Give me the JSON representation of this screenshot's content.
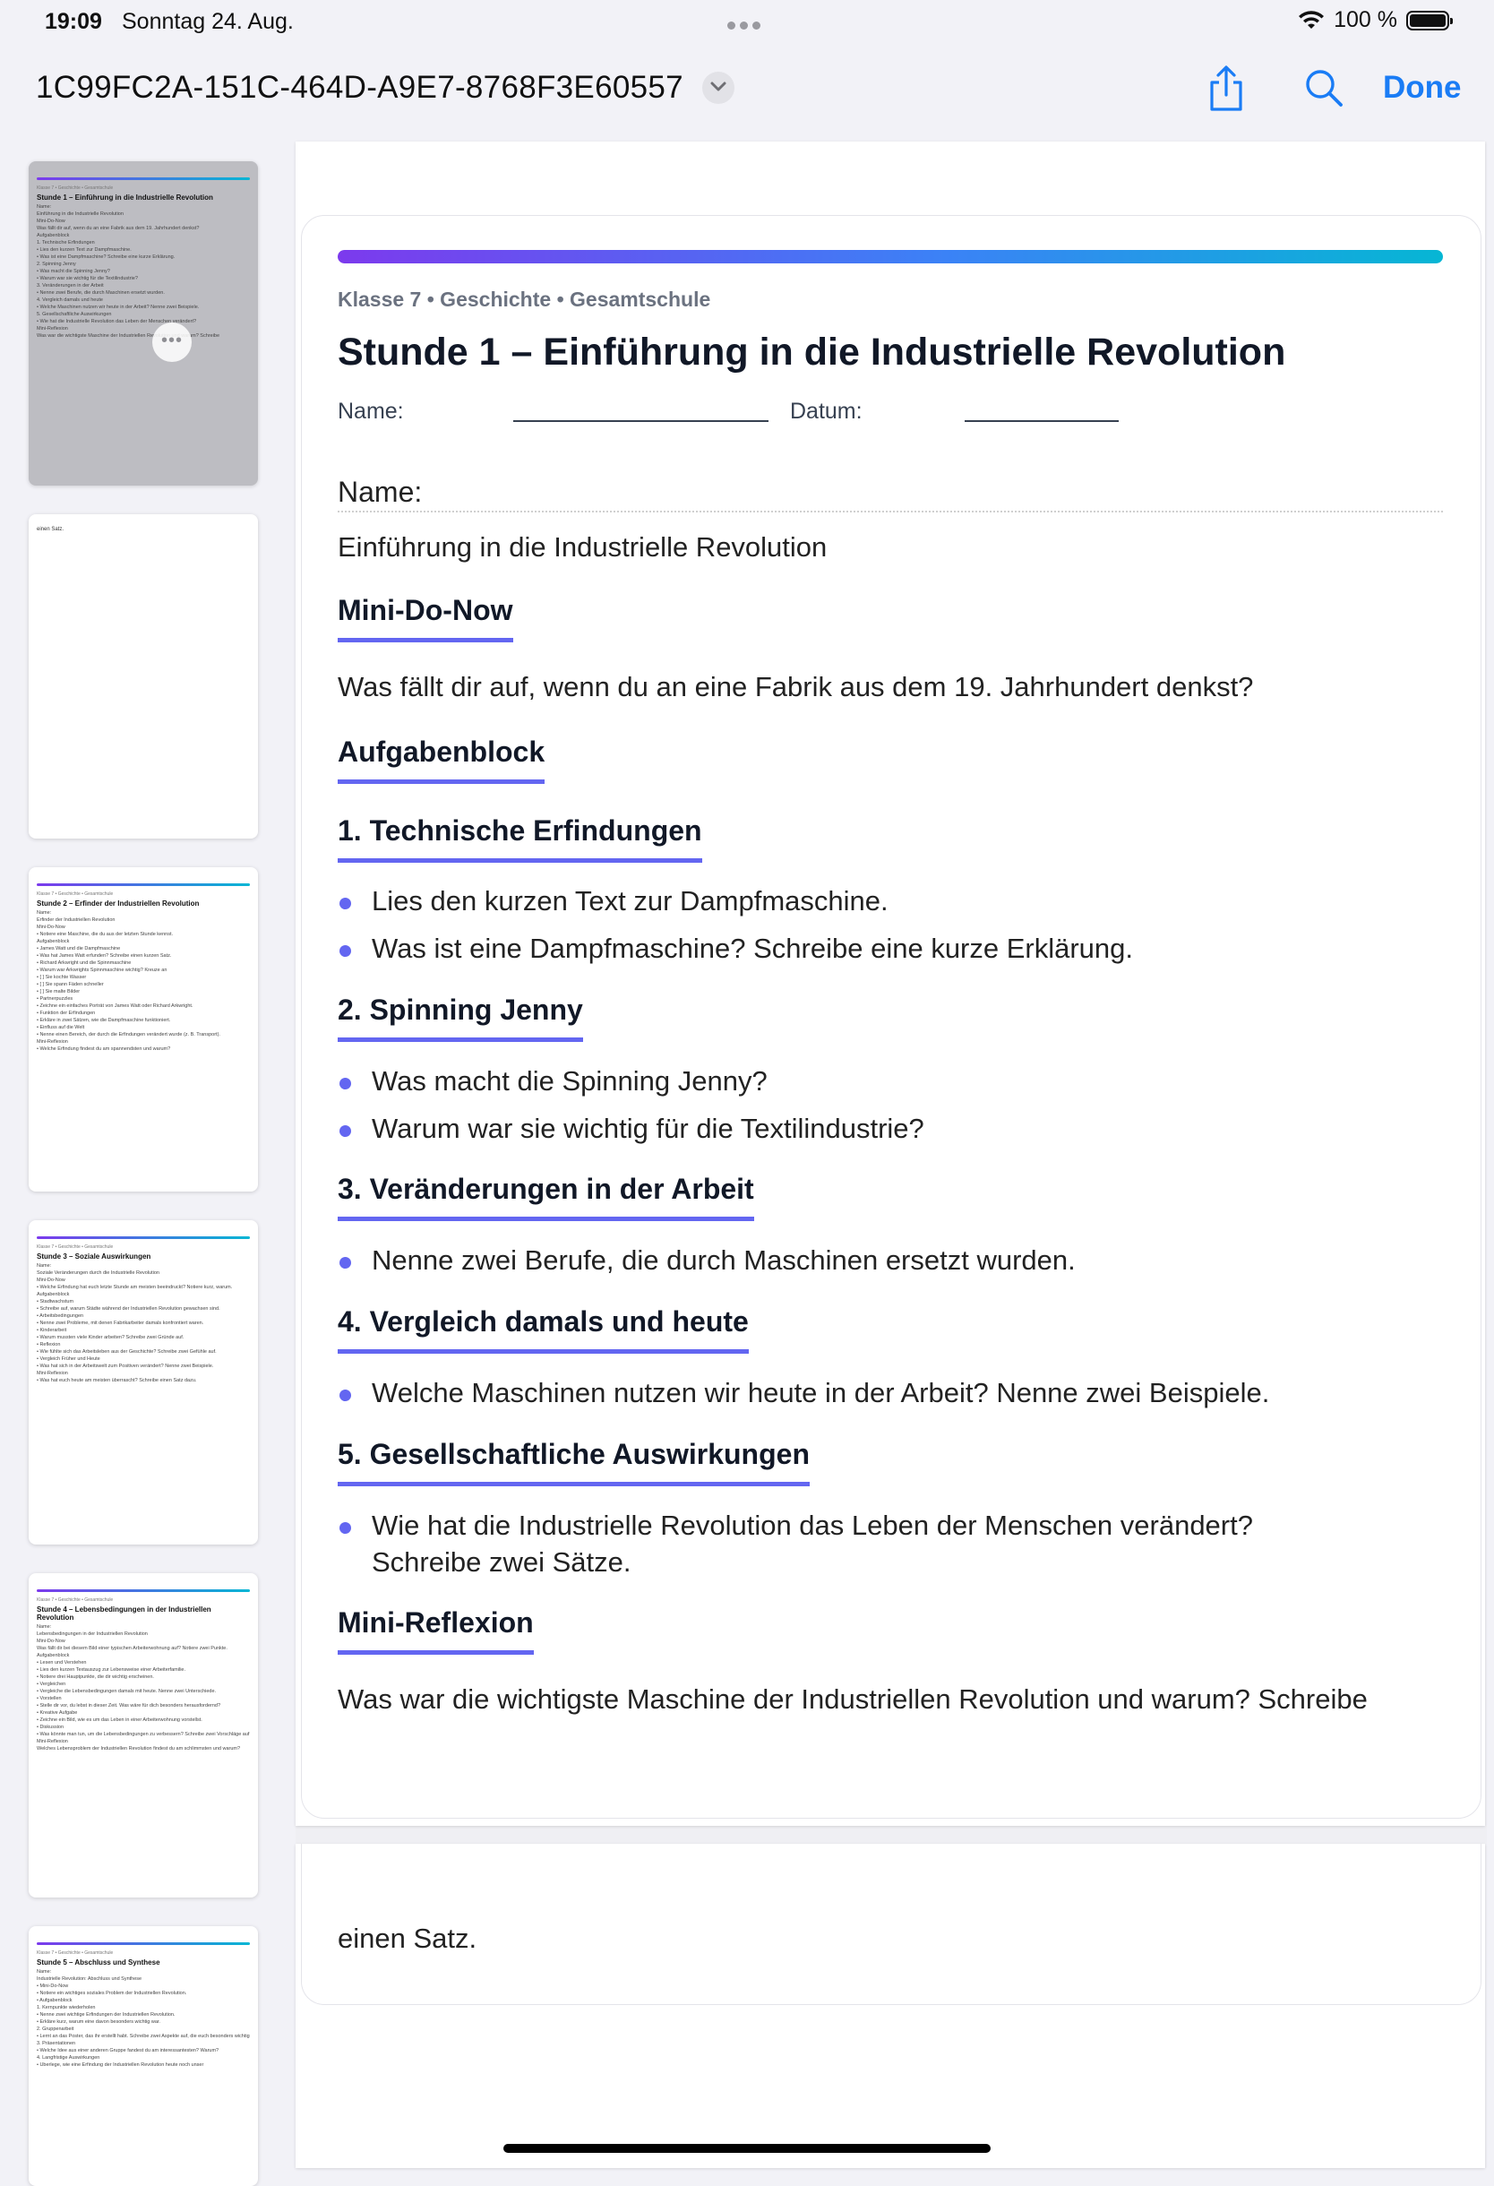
{
  "status": {
    "time": "19:09",
    "date": "Sonntag 24. Aug.",
    "battery": "100 %"
  },
  "nav": {
    "doc_title": "1C99FC2A-151C-464D-A9E7-8768F3E60557",
    "done": "Done"
  },
  "thumbnails": [
    {
      "meta": "Klasse 7 • Geschichte • Gesamtschule",
      "title": "Stunde 1 – Einführung in die Industrielle Revolution",
      "lines": [
        "Name:",
        "Einführung in die Industrielle Revolution",
        "Mini-Do-Now",
        "Was fällt dir auf, wenn du an eine Fabrik aus dem 19. Jahrhundert denkst?",
        "Aufgabenblock",
        "1. Technische Erfindungen",
        "• Lies den kurzen Text zur Dampfmaschine.",
        "• Was ist eine Dampfmaschine? Schreibe eine kurze Erklärung.",
        "2. Spinning Jenny",
        "• Was macht die Spinning Jenny?",
        "• Warum war sie wichtig für die Textilindustrie?",
        "3. Veränderungen in der Arbeit",
        "• Nenne zwei Berufe, die durch Maschinen ersetzt wurden.",
        "4. Vergleich damals und heute",
        "• Welche Maschinen nutzen wir heute in der Arbeit? Nenne zwei Beispiele.",
        "5. Gesellschaftliche Auswirkungen",
        "• Wie hat die Industrielle Revolution das Leben der Menschen verändert?",
        "Mini-Reflexion",
        "Was war die wichtigste Maschine der Industriellen Revolution und warum? Schreibe"
      ]
    },
    {
      "text": "einen Satz."
    },
    {
      "meta": "Klasse 7 • Geschichte • Gesamtschule",
      "title": "Stunde 2 – Erfinder der Industriellen Revolution",
      "lines": [
        "Name:",
        "Erfinder der Industriellen Revolution",
        "Mini-Do-Now",
        "• Notiere eine Maschine, die du aus der letzten Stunde kennst.",
        "Aufgabenblock",
        "• James Watt und die Dampfmaschine",
        "• Was hat James Watt erfunden? Schreibe einen kurzen Satz.",
        "• Richard Arkwright und die Spinnmaschine",
        "• Warum war Arkwrights Spinnmaschine wichtig? Kreuze an",
        "• [ ] Sie kochte Wasser",
        "• [ ] Sie spann Fäden schneller",
        "• [ ] Sie malte Bilder",
        "• Partnerpuzzles",
        "• Zeichne ein einfaches Porträt von James Watt oder Richard Arkwright.",
        "• Funktion der Erfindungen",
        "• Erkläre in zwei Sätzen, wie die Dampfmaschine funktioniert.",
        "• Einfluss auf die Welt",
        "• Nenne einen Bereich, der durch die Erfindungen verändert wurde (z. B. Transport).",
        "Mini-Reflexion",
        "• Welche Erfindung findest du am spannendsten und warum?"
      ]
    },
    {
      "meta": "Klasse 7 • Geschichte • Gesamtschule",
      "title": "Stunde 3 – Soziale Auswirkungen",
      "lines": [
        "Name:",
        "Soziale Veränderungen durch die Industrielle Revolution",
        "Mini-Do-Now",
        "• Welche Erfindung hat euch letzte Stunde am meisten beeindruckt? Notiere kurz, warum.",
        "Aufgabenblock",
        "• Stadtwachstum",
        "• Schreibe auf, warum Städte während der Industriellen Revolution gewachsen sind.",
        "• Arbeitsbedingungen",
        "• Nenne zwei Probleme, mit denen Fabrikarbeiter damals konfrontiert waren.",
        "• Kinderarbeit",
        "• Warum mussten viele Kinder arbeiten? Schreibe zwei Gründe auf.",
        "• Reflexion",
        "• Wie fühlte sich das Arbeitsleben aus der Geschichte? Schreibe zwei Gefühle auf.",
        "• Vergleich Früher und Heute",
        "• Was hat sich in der Arbeitswelt zum Positiven verändert? Nenne zwei Beispiele.",
        "Mini-Reflexion",
        "• Was hat euch heute am meisten überrascht? Schreibe einen Satz dazu."
      ]
    },
    {
      "meta": "Klasse 7 • Geschichte • Gesamtschule",
      "title": "Stunde 4 – Lebensbedingungen in der Industriellen Revolution",
      "lines": [
        "Name:",
        "Lebensbedingungen in der Industriellen Revolution",
        "Mini-Do-Now",
        "Was fällt dir bei diesem Bild einer typischen Arbeiterwohnung auf? Notiere zwei Punkte.",
        "Aufgabenblock",
        "• Lesen und Verstehen",
        "• Lies den kurzen Textauszug zur Lebensweise einer Arbeiterfamilie.",
        "• Notiere drei Hauptpunkte, die dir wichtig erscheinen.",
        "• Vergleichen",
        "• Vergleiche die Lebensbedingungen damals mit heute. Nenne zwei Unterschiede.",
        "• Vorstellen",
        "• Stelle dir vor, du lebst in dieser Zeit. Was wäre für dich besonders herausfordernd?",
        "• Kreative Aufgabe",
        "• Zeichne ein Bild, wie es um das Leben in einer Arbeiterwohnung vorstellst.",
        "• Diskussion",
        "• Was könnte man tun, um die Lebensbedingungen zu verbessern? Schreibe zwei Vorschläge auf.",
        "Mini-Reflexion",
        "Welches Lebensproblem der Industriellen Revolution findest du am schlimmsten und warum?"
      ]
    },
    {
      "meta": "Klasse 7 • Geschichte • Gesamtschule",
      "title": "Stunde 5 – Abschluss und Synthese",
      "lines": [
        "Name:",
        "Industrielle Revolution: Abschluss und Synthese",
        "• Mini-Do-Now",
        "• Notiere ein wichtiges soziales Problem der Industriellen Revolution.",
        "• Aufgabenblock",
        "1. Kernpunkte wiederholen",
        "• Nenne zwei wichtige Erfindungen der Industriellen Revolution.",
        "• Erkläre kurz, warum eine davon besonders wichtig war.",
        "2. Gruppenarbeit",
        "• Lernt an das Poster, das ihr erstellt habt. Schreibe zwei Aspekte auf, die euch besonders wichtig waren.",
        "3. Präsentationen",
        "• Welche Idee aus einer anderen Gruppe fandest du am interessantesten? Warum?",
        "4. Langfristige Auswirkungen",
        "• Überlege, wie eine Erfindung der Industriellen Revolution heute noch unser"
      ]
    }
  ],
  "page": {
    "meta": "Klasse 7 • Geschichte • Gesamtschule",
    "title": "Stunde 1 – Einführung in die Industrielle Revolution",
    "name_label": "Name:",
    "date_label": "Datum:",
    "name2": "Name:",
    "subtitle": "Einführung in die Industrielle Revolution",
    "sec_mini_do_now": "Mini-Do-Now",
    "mini_do_now_text": "Was fällt dir auf, wenn du an eine Fabrik aus dem 19. Jahrhundert denkst?",
    "sec_aufgabenblock": "Aufgabenblock",
    "sec1": "1. Technische Erfindungen",
    "sec1_b1": "Lies den kurzen Text zur Dampfmaschine.",
    "sec1_b2": "Was ist eine Dampfmaschine? Schreibe eine kurze Erklärung.",
    "sec2": "2. Spinning Jenny",
    "sec2_b1": "Was macht die Spinning Jenny?",
    "sec2_b2": "Warum war sie wichtig für die Textilindustrie?",
    "sec3": "3. Veränderungen in der Arbeit",
    "sec3_b1": "Nenne zwei Berufe, die durch Maschinen ersetzt wurden.",
    "sec4": "4. Vergleich damals und heute",
    "sec4_b1": "Welche Maschinen nutzen wir heute in der Arbeit? Nenne zwei Beispiele.",
    "sec5": "5. Gesellschaftliche Auswirkungen",
    "sec5_b1_l1": "Wie hat die Industrielle Revolution das Leben der Menschen verändert?",
    "sec5_b1_l2": "Schreibe zwei Sätze.",
    "sec_reflexion": "Mini-Reflexion",
    "reflexion_text": "Was war die wichtigste Maschine der Industriellen Revolution und warum? Schreibe",
    "page2_text": "einen Satz."
  },
  "colors": {
    "accent": "#6366f1",
    "link": "#1a7cf5",
    "gradient_start": "#7c3aed",
    "gradient_end": "#06b6d4"
  },
  "icons": [
    "wifi-icon",
    "battery-icon",
    "chevron-down-icon",
    "share-icon",
    "search-icon",
    "more-icon"
  ]
}
